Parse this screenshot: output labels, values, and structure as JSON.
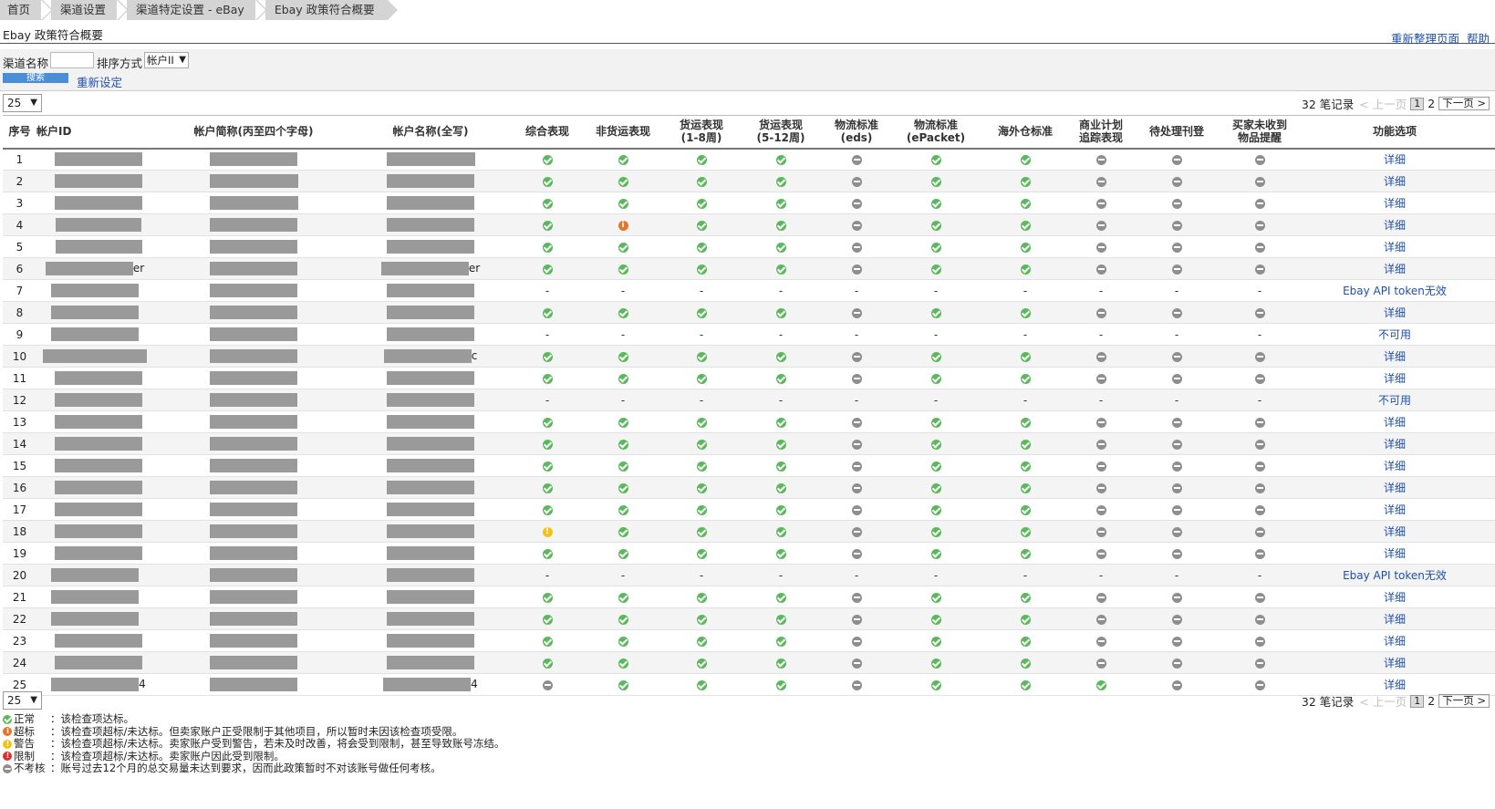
{
  "breadcrumb": [
    "首页",
    "渠道设置",
    "渠道特定设置 - eBay",
    "Ebay 政策符合概要"
  ],
  "page_title": "Ebay 政策符合概要",
  "top_links": {
    "refresh": "重新整理页面",
    "help": "帮助"
  },
  "filter": {
    "channel_label": "渠道名称",
    "channel_value": "",
    "sort_label": "排序方式",
    "sort_value": "帐户II",
    "search_button": "搜索",
    "reset_link": "重新设定"
  },
  "pagination": {
    "page_size": "25",
    "records": "32 笔记录",
    "prev": "< 上一页",
    "current_page": "1",
    "page2": "2",
    "next": "下一页 >"
  },
  "columns": [
    "序号",
    "帐户ID",
    "帐户简称(丙至四个字母)",
    "帐户名称(全写)",
    "综合表现",
    "非货运表现",
    "货运表现\n(1-8周)",
    "货运表现\n(5-12周)",
    "物流标准\n(eds)",
    "物流标准\n(ePacket)",
    "海外仓标准",
    "商业计划\n追踪表现",
    "待处理刊登",
    "买家未收到\n物品提醒",
    "功能选项"
  ],
  "status_icons": {
    "ok": "check-circle-icon",
    "na": "minus-circle-icon",
    "exceed": "info-circle-icon",
    "warn": "warning-circle-icon",
    "limit": "error-circle-icon",
    "none": "-"
  },
  "colors": {
    "ok": "#5cb85c",
    "na": "#8e8e8e",
    "exceed": "#e8742a",
    "warn": "#f2c315",
    "limit": "#d9302c",
    "link": "#1f4fa8"
  },
  "rows": [
    {
      "no": "1",
      "id_tail": "",
      "short_tail": "",
      "full_tail": "",
      "status": [
        "ok",
        "ok",
        "ok",
        "ok",
        "na",
        "ok",
        "ok",
        "na",
        "na",
        "na"
      ],
      "action": "详细"
    },
    {
      "no": "2",
      "id_tail": "",
      "short_tail": "",
      "full_tail": "",
      "status": [
        "ok",
        "ok",
        "ok",
        "ok",
        "na",
        "ok",
        "ok",
        "na",
        "na",
        "na"
      ],
      "action": "详细"
    },
    {
      "no": "3",
      "id_tail": "",
      "short_tail": "",
      "full_tail": "",
      "status": [
        "ok",
        "ok",
        "ok",
        "ok",
        "na",
        "ok",
        "ok",
        "na",
        "na",
        "na"
      ],
      "action": "详细"
    },
    {
      "no": "4",
      "id_tail": "",
      "short_tail": "",
      "full_tail": "",
      "status": [
        "ok",
        "exceed",
        "ok",
        "ok",
        "na",
        "ok",
        "ok",
        "na",
        "na",
        "na"
      ],
      "action": "详细"
    },
    {
      "no": "5",
      "id_tail": "",
      "short_tail": "",
      "full_tail": "",
      "status": [
        "ok",
        "ok",
        "ok",
        "ok",
        "na",
        "ok",
        "ok",
        "na",
        "na",
        "na"
      ],
      "action": "详细"
    },
    {
      "no": "6",
      "id_tail": "er",
      "short_tail": "",
      "full_tail": "er",
      "status": [
        "ok",
        "ok",
        "ok",
        "ok",
        "na",
        "ok",
        "ok",
        "na",
        "na",
        "na"
      ],
      "action": "详细"
    },
    {
      "no": "7",
      "id_tail": "",
      "short_tail": "",
      "full_tail": "",
      "status": [
        "none",
        "none",
        "none",
        "none",
        "none",
        "none",
        "none",
        "none",
        "none",
        "none"
      ],
      "action": "Ebay API token无效"
    },
    {
      "no": "8",
      "id_tail": "",
      "short_tail": "",
      "full_tail": "",
      "status": [
        "ok",
        "ok",
        "ok",
        "ok",
        "na",
        "ok",
        "ok",
        "na",
        "na",
        "na"
      ],
      "action": "详细"
    },
    {
      "no": "9",
      "id_tail": "",
      "short_tail": "",
      "full_tail": "",
      "status": [
        "none",
        "none",
        "none",
        "none",
        "none",
        "none",
        "none",
        "none",
        "none",
        "none"
      ],
      "action": "不可用"
    },
    {
      "no": "10",
      "id_tail": "",
      "short_tail": "",
      "full_tail": "c",
      "status": [
        "ok",
        "ok",
        "ok",
        "ok",
        "na",
        "ok",
        "ok",
        "na",
        "na",
        "na"
      ],
      "action": "详细"
    },
    {
      "no": "11",
      "id_tail": "",
      "short_tail": "",
      "full_tail": "",
      "status": [
        "ok",
        "ok",
        "ok",
        "ok",
        "na",
        "ok",
        "ok",
        "na",
        "na",
        "na"
      ],
      "action": "详细"
    },
    {
      "no": "12",
      "id_tail": "",
      "short_tail": "",
      "full_tail": "",
      "status": [
        "none",
        "none",
        "none",
        "none",
        "none",
        "none",
        "none",
        "none",
        "none",
        "none"
      ],
      "action": "不可用"
    },
    {
      "no": "13",
      "id_tail": "",
      "short_tail": "",
      "full_tail": "",
      "status": [
        "ok",
        "ok",
        "ok",
        "ok",
        "na",
        "ok",
        "ok",
        "na",
        "na",
        "na"
      ],
      "action": "详细"
    },
    {
      "no": "14",
      "id_tail": "",
      "short_tail": "",
      "full_tail": "",
      "status": [
        "ok",
        "ok",
        "ok",
        "ok",
        "na",
        "ok",
        "ok",
        "na",
        "na",
        "na"
      ],
      "action": "详细"
    },
    {
      "no": "15",
      "id_tail": "",
      "short_tail": "",
      "full_tail": "",
      "status": [
        "ok",
        "ok",
        "ok",
        "ok",
        "na",
        "ok",
        "ok",
        "na",
        "na",
        "na"
      ],
      "action": "详细"
    },
    {
      "no": "16",
      "id_tail": "",
      "short_tail": "",
      "full_tail": "",
      "status": [
        "ok",
        "ok",
        "ok",
        "ok",
        "na",
        "ok",
        "ok",
        "na",
        "na",
        "na"
      ],
      "action": "详细"
    },
    {
      "no": "17",
      "id_tail": "",
      "short_tail": "",
      "full_tail": "",
      "status": [
        "ok",
        "ok",
        "ok",
        "ok",
        "na",
        "ok",
        "ok",
        "na",
        "na",
        "na"
      ],
      "action": "详细"
    },
    {
      "no": "18",
      "id_tail": "",
      "short_tail": "",
      "full_tail": "",
      "status": [
        "warn",
        "ok",
        "ok",
        "ok",
        "na",
        "ok",
        "ok",
        "na",
        "na",
        "na"
      ],
      "action": "详细"
    },
    {
      "no": "19",
      "id_tail": "",
      "short_tail": "",
      "full_tail": "",
      "status": [
        "ok",
        "ok",
        "ok",
        "ok",
        "na",
        "ok",
        "ok",
        "na",
        "na",
        "na"
      ],
      "action": "详细"
    },
    {
      "no": "20",
      "id_tail": "",
      "short_tail": "",
      "full_tail": "",
      "status": [
        "none",
        "none",
        "none",
        "none",
        "none",
        "none",
        "none",
        "none",
        "none",
        "none"
      ],
      "action": "Ebay API token无效"
    },
    {
      "no": "21",
      "id_tail": "",
      "short_tail": "",
      "full_tail": "",
      "status": [
        "ok",
        "ok",
        "ok",
        "ok",
        "na",
        "ok",
        "ok",
        "na",
        "na",
        "na"
      ],
      "action": "详细"
    },
    {
      "no": "22",
      "id_tail": "",
      "short_tail": "",
      "full_tail": "",
      "status": [
        "ok",
        "ok",
        "ok",
        "ok",
        "na",
        "ok",
        "ok",
        "na",
        "na",
        "na"
      ],
      "action": "详细"
    },
    {
      "no": "23",
      "id_tail": "",
      "short_tail": "",
      "full_tail": "",
      "status": [
        "ok",
        "ok",
        "ok",
        "ok",
        "na",
        "ok",
        "ok",
        "na",
        "na",
        "na"
      ],
      "action": "详细"
    },
    {
      "no": "24",
      "id_tail": "",
      "short_tail": "",
      "full_tail": "",
      "status": [
        "ok",
        "ok",
        "ok",
        "ok",
        "na",
        "ok",
        "ok",
        "na",
        "na",
        "na"
      ],
      "action": "详细"
    },
    {
      "no": "25",
      "id_tail": "4",
      "short_tail": "",
      "full_tail": "4",
      "status": [
        "na",
        "ok",
        "ok",
        "ok",
        "na",
        "ok",
        "ok",
        "ok",
        "na",
        "na"
      ],
      "action": "详细"
    }
  ],
  "legend": [
    {
      "type": "ok",
      "name": "正常",
      "desc": "：该检查项达标。"
    },
    {
      "type": "exceed",
      "name": "超标",
      "desc": "：该检查项超标/未达标。但卖家账户正受限制于其他项目，所以暂时未因该检查项受限。"
    },
    {
      "type": "warn",
      "name": "警告",
      "desc": "：该检查项超标/未达标。卖家账户受到警告，若未及时改善，将会受到限制，甚至导致账号冻结。"
    },
    {
      "type": "limit",
      "name": "限制",
      "desc": "：该检查项超标/未达标。卖家账户因此受到限制。"
    },
    {
      "type": "na",
      "name": "不考核",
      "desc": "：账号过去12个月的总交易量未达到要求，因而此政策暂时不对该账号做任何考核。"
    }
  ]
}
